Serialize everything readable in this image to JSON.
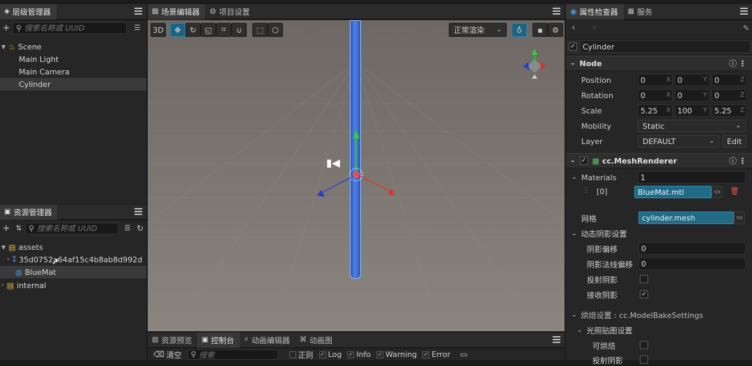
{
  "hierarchy": {
    "tab_label": "层级管理器",
    "search_placeholder": "搜索名称或 UUID",
    "items": [
      {
        "label": "Scene"
      },
      {
        "label": "Main Light"
      },
      {
        "label": "Main Camera"
      },
      {
        "label": "Cylinder"
      }
    ]
  },
  "assets": {
    "tab_label": "资源管理器",
    "search_placeholder": "搜索名称或 UUID",
    "items": [
      {
        "label": "assets"
      },
      {
        "label": "35d0752a64af15c4b8ab8d992d"
      },
      {
        "label": "BlueMat"
      },
      {
        "label": "internal"
      }
    ]
  },
  "scene": {
    "tabs": [
      {
        "label": "场景编辑器"
      },
      {
        "label": "项目设置"
      }
    ],
    "mode_3d": "3D",
    "render_mode": "正常渲染",
    "colors": {
      "bg_top": "#6f6a66",
      "bg_bottom": "#8a847e",
      "cylinder": "#3d6fd6"
    }
  },
  "bottom": {
    "tabs": [
      {
        "label": "资源预览"
      },
      {
        "label": "控制台"
      },
      {
        "label": "动画编辑器"
      },
      {
        "label": "动画图"
      }
    ],
    "clear_label": "清空",
    "search_placeholder": "搜索",
    "filters": [
      {
        "label": "正则",
        "checked": false
      },
      {
        "label": "Log",
        "checked": true
      },
      {
        "label": "Info",
        "checked": true
      },
      {
        "label": "Warning",
        "checked": true
      },
      {
        "label": "Error",
        "checked": true
      }
    ]
  },
  "inspector": {
    "tabs": [
      {
        "label": "属性检查器"
      },
      {
        "label": "服务"
      }
    ],
    "node_name": "Cylinder",
    "node_section": "Node",
    "position": {
      "label": "Position",
      "x": "0",
      "y": "0",
      "z": "0"
    },
    "rotation": {
      "label": "Rotation",
      "x": "0",
      "y": "0",
      "z": "0"
    },
    "scale": {
      "label": "Scale",
      "x": "5.25",
      "y": "100",
      "z": "5.25"
    },
    "mobility": {
      "label": "Mobility",
      "value": "Static"
    },
    "layer": {
      "label": "Layer",
      "value": "DEFAULT",
      "edit_label": "Edit"
    },
    "axis": {
      "x": "X",
      "y": "Y",
      "z": "Z"
    },
    "mesh_renderer": {
      "title": "cc.MeshRenderer",
      "materials_label": "Materials",
      "materials_count": "1",
      "material_index": "[0]",
      "material_value": "BlueMat.mtl",
      "mesh_label": "网格",
      "mesh_value": "cylinder.mesh",
      "shadow_section": "动态阴影设置",
      "shadow_bias_label": "阴影偏移",
      "shadow_bias": "0",
      "shadow_normal_bias_label": "阴影法线偏移",
      "shadow_normal_bias": "0",
      "cast_shadow_label": "投射阴影",
      "receive_shadow_label": "接收阴影",
      "bake_section": "烘焙设置 : cc.ModelBakeSettings",
      "lightmap_section": "光照贴图设置",
      "bakeable_label": "可烘焙",
      "cast_shadow2_label": "投射阴影"
    }
  }
}
